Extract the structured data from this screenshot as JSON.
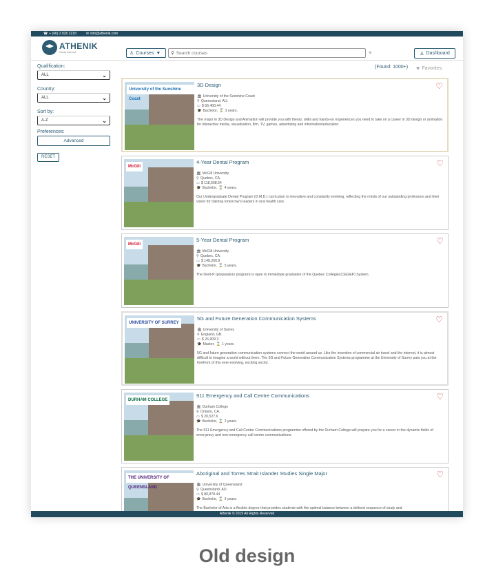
{
  "topbar": {
    "phone": "+ (66) 2 026 2218",
    "email": "info@athenik.com"
  },
  "header": {
    "logo": "ATHENIK",
    "logo_tagline": "Study Abroad",
    "courses_label": "Courses",
    "search_placeholder": "Search courses",
    "dashboard_label": "Dashboard"
  },
  "sidebar": {
    "qualification_label": "Qualification:",
    "qualification_value": "ALL",
    "country_label": "Country:",
    "country_value": "ALL",
    "sort_label": "Sort by:",
    "sort_value": "A-Z",
    "preferences_label": "Preferences:",
    "advanced_label": "Advanced",
    "reset_label": "RESET"
  },
  "results": {
    "found": "(Found: 1000+)",
    "favorites_label": "Favorites"
  },
  "courses": [
    {
      "title": "3D Design",
      "university": "University of the Sunshine Coast",
      "logo_text": "University of the Sunshine Coast",
      "logo_color": "#1c6fb5",
      "location": "Queensland, AU.",
      "fee": "$ 66,400.44",
      "degree": "Bachelor,",
      "duration": "3 years.",
      "description": "The major in 3D Design and Animation will provide you with theory, skills and hands-on experiences you need to take on a career in 3D design or animation for interactive media, visualisation, film, TV, games, advertising and information/education."
    },
    {
      "title": "4-Year Dental Program",
      "university": "McGill University",
      "logo_text": "McGill",
      "logo_color": "#d0142b",
      "location": "Quebec, CA.",
      "fee": "$ 118,608.64",
      "degree": "Bachelor,",
      "duration": "4 years.",
      "description": "Our Undergraduate Dental Program (D.M.D.) curriculum is innovative and constantly evolving, reflecting the minds of our outstanding professors and their vision for training tomorrow's leaders in oral health care."
    },
    {
      "title": "5-Year Dental Program",
      "university": "McGill University",
      "logo_text": "McGill",
      "logo_color": "#d0142b",
      "location": "Quebec, CA.",
      "fee": "$ 148,260.8",
      "degree": "Bachelor,",
      "duration": "5 years.",
      "description": "The Dent-P (preparatory program) is open to immediate graduates of the Quebec Collegial (CEGEP) System."
    },
    {
      "title": "5G and Future Generation Communication Systems",
      "university": "University of Surrey",
      "logo_text": "UNIVERSITY OF SURREY",
      "logo_color": "#2b4a9c",
      "location": "England, GB.",
      "fee": "$ 26,909.3",
      "degree": "Master,",
      "duration": "1 years.",
      "description": "5G and future generation communication systems connect the world around us. Like the invention of commercial air travel and the internet, it is almost difficult to imagine a world without them. The 5G and Future Generation Communication Systems programme at the University of Surrey puts you at the forefront of this ever-evolving, exciting sector."
    },
    {
      "title": "911 Emergency and Call Centre Communications",
      "university": "Durham College",
      "logo_text": "DURHAM COLLEGE",
      "logo_color": "#0b6b45",
      "location": "Ontario, CA.",
      "fee": "$ 20,527.6",
      "degree": "Bachelor,",
      "duration": "2 years.",
      "description": "The 911 Emergency and Call Centre Communications programme offered by the Durham College will prepare you for a career in the dynamic fields of emergency and non-emergency call centre communications."
    },
    {
      "title": "Aboriginal and Torres Strait Islander Studies Single Major",
      "university": "University of Queensland",
      "logo_text": "THE UNIVERSITY OF QUEENSLAND",
      "logo_color": "#51247a",
      "location": "Queensland, AU.",
      "fee": "$ 80,878.44",
      "degree": "Bachelor,",
      "duration": "3 years.",
      "description": "The Bachelor of Arts is a flexible degree that provides students with the optimal balance between a defined sequence of study and"
    }
  ],
  "footer": "Athenik © 2019 All Rights Reserved",
  "caption": "Old design"
}
